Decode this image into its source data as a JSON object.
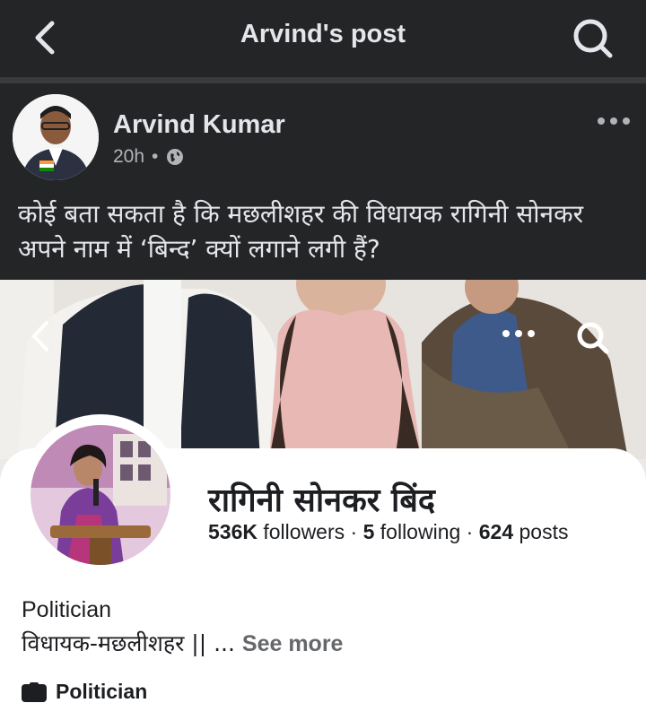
{
  "header": {
    "title": "Arvind's post",
    "back_icon": "chevron-left-icon",
    "search_icon": "search-icon"
  },
  "post": {
    "author": "Arvind Kumar",
    "time": "20h",
    "separator": "•",
    "privacy_icon": "globe-icon",
    "more_icon": "ellipsis-icon",
    "text": "कोई बता सकता है कि मछलीशहर की विधायक रागिनी सोनकर अपने नाम में ‘बिन्द’ क्यों लगाने लगी हैं?"
  },
  "screenshot": {
    "profile_name": "रागिनी सोनकर बिंद",
    "followers_count": "536K",
    "followers_label": "followers",
    "following_count": "5",
    "following_label": "following",
    "posts_count": "624",
    "posts_label": "posts",
    "dot": "·",
    "category": "Politician",
    "bio": "विधायक-मछलीशहर || ...",
    "see_more": "See more",
    "tag_label": "Politician"
  },
  "colors": {
    "background": "#242526",
    "text_primary": "#e4e6eb",
    "text_secondary": "#b0b3b8",
    "card": "#ffffff"
  }
}
